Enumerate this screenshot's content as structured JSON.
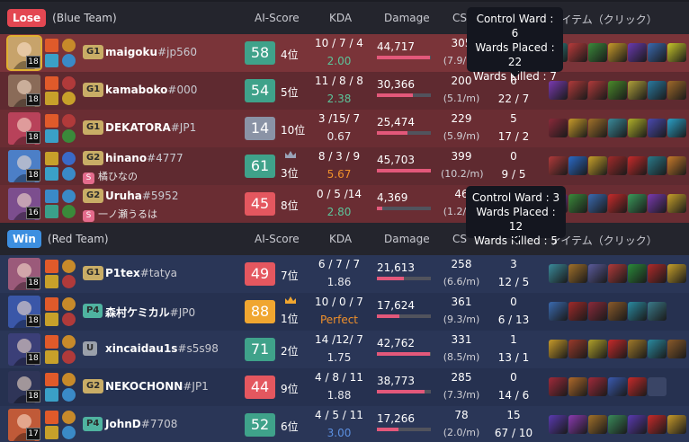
{
  "columns": {
    "ai_score": "AI-Score",
    "kda": "KDA",
    "damage": "Damage",
    "cs": "CS",
    "items": "アイテム（クリック）"
  },
  "blue_team": {
    "result": "Lose",
    "result_color": "#e34752",
    "name": "(Blue Team)",
    "players": [
      {
        "level": "18",
        "tier": "G1",
        "tier_color": "#c9ad66",
        "name": "maigoku",
        "tag": "#jp560",
        "sub": "",
        "score": "58",
        "score_color": "#3fa28a",
        "rank": "4位",
        "crown": false,
        "kda": "10 / 7 / 4",
        "ratio": "2.00",
        "ratio_color": "#5cc49a",
        "damage": "44,717",
        "damage_ratio": 0.98,
        "cs": "305",
        "cs_min": "(7.9/m)",
        "wards": "",
        "wards_detail": "",
        "champ_color": "#c7a36b"
      },
      {
        "level": "18",
        "tier": "G1",
        "tier_color": "#c9ad66",
        "name": "kamaboko",
        "tag": "#000",
        "sub": "",
        "score": "54",
        "score_color": "#3fa28a",
        "rank": "5位",
        "crown": false,
        "kda": "11 / 8 / 8",
        "ratio": "2.38",
        "ratio_color": "#5cc49a",
        "damage": "30,366",
        "damage_ratio": 0.66,
        "cs": "200",
        "cs_min": "(5.1/m)",
        "wards": "6",
        "wards_detail": "22 / 7",
        "champ_color": "#8a6b58"
      },
      {
        "level": "18",
        "tier": "G1",
        "tier_color": "#c9ad66",
        "name": "DEKATORA",
        "tag": "#JP1",
        "sub": "",
        "score": "14",
        "score_color": "#8a93a6",
        "rank": "10位",
        "crown": false,
        "kda": "3 /15/ 7",
        "ratio": "0.67",
        "ratio_color": "#e8e8ec",
        "damage": "25,474",
        "damage_ratio": 0.56,
        "cs": "229",
        "cs_min": "(5.9/m)",
        "wards": "5",
        "wards_detail": "17 / 2",
        "champ_color": "#b8425a"
      },
      {
        "level": "18",
        "tier": "G2",
        "tier_color": "#c9ad66",
        "name": "hinano",
        "tag": "#4777",
        "sub": "橘ひなの",
        "score": "61",
        "score_color": "#3fa28a",
        "rank": "3位",
        "crown": true,
        "crown_color": "#9aa3b8",
        "kda": "8 / 3 / 9",
        "ratio": "5.67",
        "ratio_color": "#f0902a",
        "damage": "45,703",
        "damage_ratio": 1.0,
        "cs": "399",
        "cs_min": "(10.2/m)",
        "wards": "0",
        "wards_detail": "9 / 5",
        "champ_color": "#4c7fc7"
      },
      {
        "level": "16",
        "tier": "G2",
        "tier_color": "#c9ad66",
        "name": "Uruha",
        "tag": "#5952",
        "sub": "一ノ瀬うるは",
        "score": "45",
        "score_color": "#e4575f",
        "rank": "8位",
        "crown": false,
        "kda": "0 / 5 /14",
        "ratio": "2.80",
        "ratio_color": "#5cc49a",
        "damage": "4,369",
        "damage_ratio": 0.1,
        "cs": "46",
        "cs_min": "(1.2/m)",
        "wards": "",
        "wards_detail": "",
        "champ_color": "#7c4e8e"
      }
    ]
  },
  "red_team": {
    "result": "Win",
    "result_color": "#3d8fe0",
    "name": "(Red Team)",
    "players": [
      {
        "level": "18",
        "tier": "G1",
        "tier_color": "#c9ad66",
        "name": "P1tex",
        "tag": "#tatya",
        "sub": "",
        "score": "49",
        "score_color": "#e4575f",
        "rank": "7位",
        "crown": false,
        "kda": "6 / 7 / 7",
        "ratio": "1.86",
        "ratio_color": "#e8e8ec",
        "damage": "21,613",
        "damage_ratio": 0.5,
        "cs": "258",
        "cs_min": "(6.6/m)",
        "wards": "3",
        "wards_detail": "12 / 5",
        "champ_color": "#9b5a7a"
      },
      {
        "level": "18",
        "tier": "P4",
        "tier_color": "#4fb3a0",
        "name": "森村ケミカル",
        "tag": "#JP0",
        "sub": "",
        "score": "88",
        "score_color": "#f0a630",
        "rank": "1位",
        "crown": true,
        "crown_color": "#f0a630",
        "kda": "10 / 0 / 7",
        "ratio": "Perfect",
        "ratio_color": "#f0902a",
        "damage": "17,624",
        "damage_ratio": 0.41,
        "cs": "361",
        "cs_min": "(9.3/m)",
        "wards": "0",
        "wards_detail": "6 / 13",
        "champ_color": "#3a57a8"
      },
      {
        "level": "18",
        "tier": "U",
        "tier_color": "#9aa0aa",
        "name": "xincaidau1s",
        "tag": "#s5s98",
        "sub": "",
        "score": "71",
        "score_color": "#3fa28a",
        "rank": "2位",
        "crown": false,
        "kda": "14 /12/ 7",
        "ratio": "1.75",
        "ratio_color": "#e8e8ec",
        "damage": "42,762",
        "damage_ratio": 0.98,
        "cs": "331",
        "cs_min": "(8.5/m)",
        "wards": "1",
        "wards_detail": "13 / 1",
        "champ_color": "#3b3f78"
      },
      {
        "level": "18",
        "tier": "G2",
        "tier_color": "#c9ad66",
        "name": "NEKOCHONN",
        "tag": "#JP1",
        "sub": "",
        "score": "44",
        "score_color": "#e4575f",
        "rank": "9位",
        "crown": false,
        "kda": "4 / 8 / 11",
        "ratio": "1.88",
        "ratio_color": "#e8e8ec",
        "damage": "38,773",
        "damage_ratio": 0.88,
        "cs": "285",
        "cs_min": "(7.3/m)",
        "wards": "0",
        "wards_detail": "14 / 6",
        "champ_color": "#2f3558"
      },
      {
        "level": "17",
        "tier": "P4",
        "tier_color": "#4fb3a0",
        "name": "JohnD",
        "tag": "#7708",
        "sub": "",
        "score": "52",
        "score_color": "#3fa28a",
        "rank": "6位",
        "crown": false,
        "kda": "4 / 5 / 11",
        "ratio": "3.00",
        "ratio_color": "#5b8fe0",
        "damage": "17,266",
        "damage_ratio": 0.4,
        "cs": "78",
        "cs_min": "(2.0/m)",
        "wards": "15",
        "wards_detail": "67 / 10",
        "champ_color": "#c05a38"
      }
    ]
  },
  "tooltips": [
    {
      "control": "Control Ward : 6",
      "placed": "Wards Placed :",
      "placed_value": "22",
      "killed": "Wards Killed : 7"
    },
    {
      "control": "Control Ward : 3",
      "placed": "Wards Placed : 12",
      "killed": "Wards Killed : 5"
    }
  ]
}
